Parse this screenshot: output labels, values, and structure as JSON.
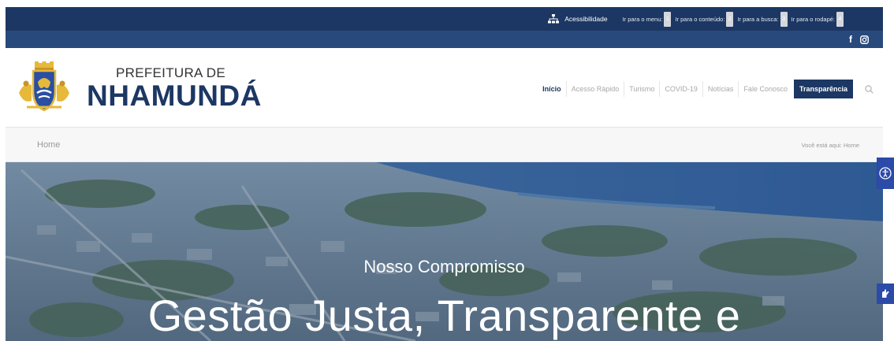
{
  "topbar": {
    "accessibility_label": "Acessibilidade",
    "skip_links": [
      {
        "label": "Ir para o menu:",
        "key": "1"
      },
      {
        "label": "Ir para o conteúdo:",
        "key": "2"
      },
      {
        "label": "Ir para a busca:",
        "key": "3"
      },
      {
        "label": "Ir para o rodapé:",
        "key": "4"
      }
    ]
  },
  "social": {
    "facebook": "f"
  },
  "brand": {
    "line1": "PREFEITURA DE",
    "line2": "NHAMUNDÁ"
  },
  "nav": {
    "items": [
      "Início",
      "Acesso Rápido",
      "Turismo",
      "COVID-19",
      "Notícias",
      "Fale Conosco"
    ],
    "highlight": "Transparência"
  },
  "breadcrumb": {
    "title": "Home",
    "trail_label": "Você está aqui:",
    "trail_current": "Home"
  },
  "hero": {
    "subtitle": "Nosso Compromisso",
    "title": "Gestão Justa, Transparente e"
  },
  "colors": {
    "primary": "#1c3763",
    "secondary": "#28497c",
    "side_button": "#2c4aa8"
  }
}
